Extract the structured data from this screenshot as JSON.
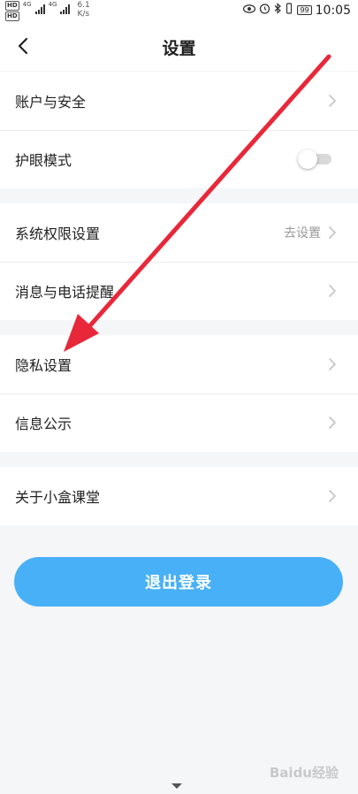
{
  "status_bar": {
    "hd1": "HD",
    "hd2": "HD",
    "net1": "4G",
    "net2": "4G",
    "speed_value": "6.1",
    "speed_unit": "K/s",
    "battery": "99",
    "time": "10:05"
  },
  "header": {
    "title": "设置"
  },
  "sections": [
    {
      "items": [
        {
          "label": "账户与安全"
        },
        {
          "label": "护眼模式",
          "toggle": "off"
        }
      ]
    },
    {
      "items": [
        {
          "label": "系统权限设置",
          "value": "去设置"
        },
        {
          "label": "消息与电话提醒"
        }
      ]
    },
    {
      "items": [
        {
          "label": "隐私设置"
        },
        {
          "label": "信息公示"
        }
      ]
    },
    {
      "items": [
        {
          "label": "关于小盒课堂"
        }
      ]
    }
  ],
  "logout_label": "退出登录",
  "watermark": "Baidu经验",
  "colors": {
    "accent": "#48b0f6",
    "annotation_arrow": "#e8283a",
    "page_bg": "#f5f6f8"
  }
}
